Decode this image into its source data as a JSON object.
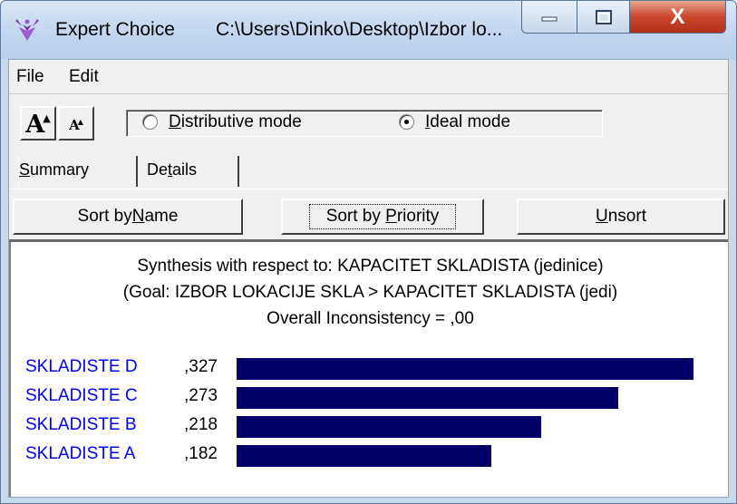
{
  "window": {
    "app_title": "Expert Choice",
    "file_path": "C:\\Users\\Dinko\\Desktop\\Izbor lo...",
    "min_icon": "minimize-icon",
    "max_icon": "maximize-icon",
    "close_icon": "close-icon",
    "close_glyph": "X"
  },
  "menu": {
    "file": "File",
    "edit": "Edit"
  },
  "toolbar": {
    "font_increase_glyph": "A",
    "font_decrease_glyph": "A",
    "distributive": {
      "mnemonic": "D",
      "rest": "istributive mode",
      "checked": false
    },
    "ideal": {
      "mnemonic": "I",
      "rest": "deal mode",
      "checked": true
    }
  },
  "tabs": [
    {
      "mnemonic": "S",
      "rest": "ummary",
      "active": true
    },
    {
      "pre": "De",
      "mnemonic": "t",
      "rest": "ails",
      "active": false
    }
  ],
  "sort_buttons": {
    "by_name": {
      "pre": "Sort by ",
      "mnemonic": "N",
      "rest": "ame"
    },
    "by_priority": {
      "pre": "Sort by ",
      "mnemonic": "P",
      "rest": "riority"
    },
    "unsort": {
      "mnemonic": "U",
      "rest": "nsort"
    }
  },
  "synthesis": {
    "line1": "Synthesis with respect to: KAPACITET SKLADISTA (jedinice)",
    "line2": "(Goal: IZBOR LOKACIJE SKLA > KAPACITET SKLADISTA (jedi)",
    "line3": "Overall Inconsistency = ,00"
  },
  "results": [
    {
      "name": "SKLADISTE D",
      "value_label": ",327",
      "value": 0.327
    },
    {
      "name": "SKLADISTE C",
      "value_label": ",273",
      "value": 0.273
    },
    {
      "name": "SKLADISTE B",
      "value_label": ",218",
      "value": 0.218
    },
    {
      "name": "SKLADISTE A",
      "value_label": ",182",
      "value": 0.182
    }
  ],
  "colors": {
    "bar": "#000066",
    "alternative_name": "#0000ff"
  }
}
